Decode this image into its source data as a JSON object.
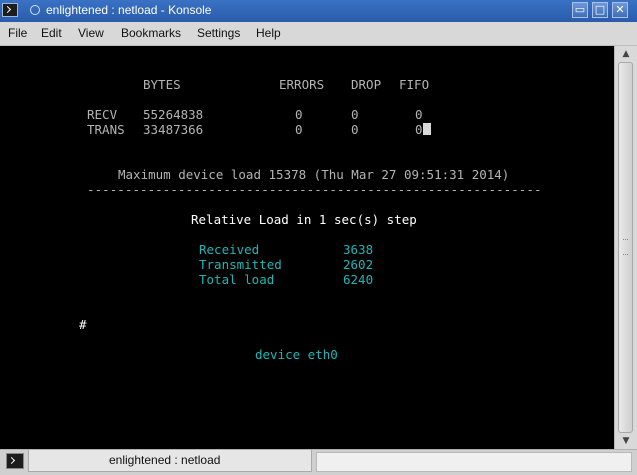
{
  "window": {
    "title": "enlightened : netload - Konsole",
    "buttons": {
      "minimize": "▭",
      "maximize": "□",
      "close": "✕"
    }
  },
  "menu": {
    "items": [
      "File",
      "Edit",
      "View",
      "Bookmarks",
      "Settings",
      "Help"
    ]
  },
  "terminal": {
    "header": {
      "bytes": "BYTES",
      "errors": "ERRORS",
      "drop": "DROP",
      "fifo": "FIFO"
    },
    "rows": [
      {
        "label": "RECV",
        "bytes": "55264838",
        "errors": "0",
        "drop": "0",
        "fifo": "0"
      },
      {
        "label": "TRANS",
        "bytes": "33487366",
        "errors": "0",
        "drop": "0",
        "fifo": "0"
      }
    ],
    "max_load_line": "Maximum device load 15378 (Thu Mar 27 09:51:31 2014)",
    "separator": "------------------------------------------------------------",
    "relative_load_title": "Relative Load in 1 sec(s) step",
    "load_stats": [
      {
        "label": "Received",
        "value": "3638"
      },
      {
        "label": "Transmitted",
        "value": "2602"
      },
      {
        "label": "Total load",
        "value": "6240"
      }
    ],
    "graph_marker": "#",
    "device_line": "device eth0"
  },
  "tabbar": {
    "active_tab": "enlightened : netload"
  },
  "colors": {
    "titlebar": "#2f63b4",
    "terminal_bg": "#000000",
    "text_gray": "#b4b4b4",
    "text_cyan": "#1fb5b5"
  }
}
